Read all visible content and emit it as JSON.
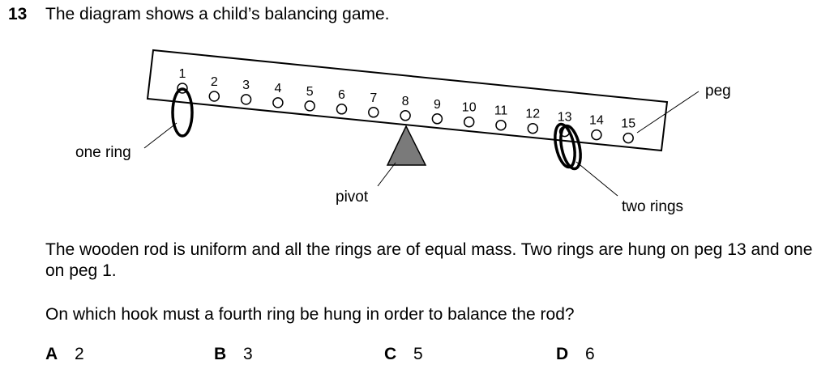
{
  "question": {
    "number": "13",
    "title": "The diagram shows a child’s balancing game."
  },
  "diagram": {
    "peg_numbers": [
      "1",
      "2",
      "3",
      "4",
      "5",
      "6",
      "7",
      "8",
      "9",
      "10",
      "11",
      "12",
      "13",
      "14",
      "15"
    ],
    "labels": {
      "one_ring": "one ring",
      "pivot": "pivot",
      "peg": "peg",
      "two_rings": "two rings"
    },
    "rings": {
      "peg_1": 1,
      "peg_13": 2
    },
    "colors": {
      "pivot_fill": "#7a7a7a",
      "stroke": "#000000"
    }
  },
  "body": {
    "paragraph_1": "The wooden rod is uniform and all the rings are of equal mass. Two rings are hung on peg 13 and one on peg 1.",
    "paragraph_2": "On which hook must a fourth ring be hung in order to balance the rod?"
  },
  "options": [
    {
      "letter": "A",
      "value": "2"
    },
    {
      "letter": "B",
      "value": "3"
    },
    {
      "letter": "C",
      "value": "5"
    },
    {
      "letter": "D",
      "value": "6"
    }
  ]
}
